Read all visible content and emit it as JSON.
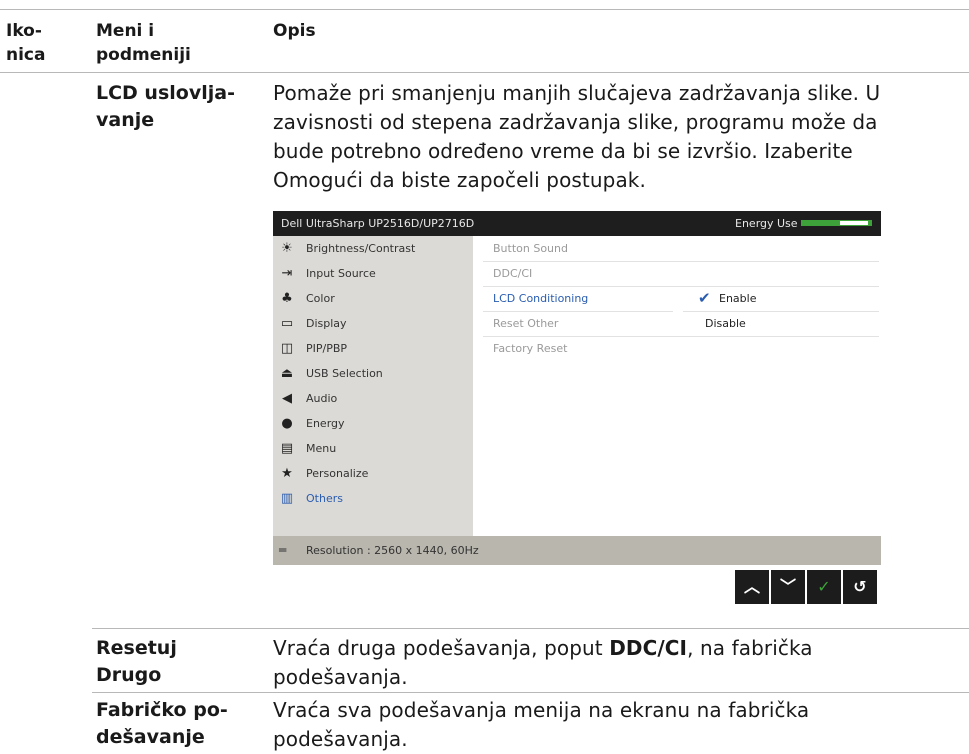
{
  "header": {
    "col1": "Iko-\nnica",
    "col1_a": "Iko-",
    "col1_b": "nica",
    "col2_a": "Meni i",
    "col2_b": "podmeniji",
    "col3": "Opis"
  },
  "rows": [
    {
      "name_a": "LCD uslovlja-",
      "name_b": "vanje",
      "desc_lines": [
        "Pomaže pri smanjenju manjih slučajeva zadržavanja slike. U",
        "zavisnosti od stepena zadržavanja slike, programu može da",
        "bude potrebno određeno vreme da bi se izvršio. Izaberite",
        "Omogući da biste započeli postupak."
      ]
    },
    {
      "name_a": "Resetuj",
      "name_b": "Drugo",
      "desc_pre": "Vraća druga podešavanja, poput ",
      "desc_bold": "DDC/CI",
      "desc_post": ", na fabrička",
      "desc_line2": "podešavanja."
    },
    {
      "name_a": "Fabričko po-",
      "name_b": "dešavanje",
      "desc_line1": "Vraća sva podešavanja menija na ekranu na fabrička",
      "desc_line2": "podešavanja."
    }
  ],
  "osd": {
    "title": "Dell UltraSharp UP2516D/UP2716D",
    "energy_label": "Energy Use",
    "menu": [
      {
        "label": "Brightness/Contrast",
        "icon": "sun-icon"
      },
      {
        "label": "Input Source",
        "icon": "input-icon"
      },
      {
        "label": "Color",
        "icon": "color-icon"
      },
      {
        "label": "Display",
        "icon": "monitor-icon"
      },
      {
        "label": "PIP/PBP",
        "icon": "pip-icon"
      },
      {
        "label": "USB Selection",
        "icon": "usb-icon"
      },
      {
        "label": "Audio",
        "icon": "speaker-icon"
      },
      {
        "label": "Energy",
        "icon": "drop-icon"
      },
      {
        "label": "Menu",
        "icon": "menu-icon"
      },
      {
        "label": "Personalize",
        "icon": "star-icon"
      },
      {
        "label": "Others",
        "icon": "others-icon"
      }
    ],
    "options": [
      "Button Sound",
      "DDC/CI",
      "LCD Conditioning",
      "Reset Other",
      "Factory Reset"
    ],
    "choices": [
      "Enable",
      "Disable"
    ],
    "resolution": "Resolution : 2560 x 1440, 60Hz",
    "accent": "#2a5db0",
    "energy_color": "#3da23a"
  },
  "nav_buttons": [
    {
      "name": "up-button",
      "glyph": "^"
    },
    {
      "name": "down-button",
      "glyph": "v"
    },
    {
      "name": "confirm-button",
      "glyph": "✓"
    },
    {
      "name": "back-button",
      "glyph": "↺"
    }
  ]
}
